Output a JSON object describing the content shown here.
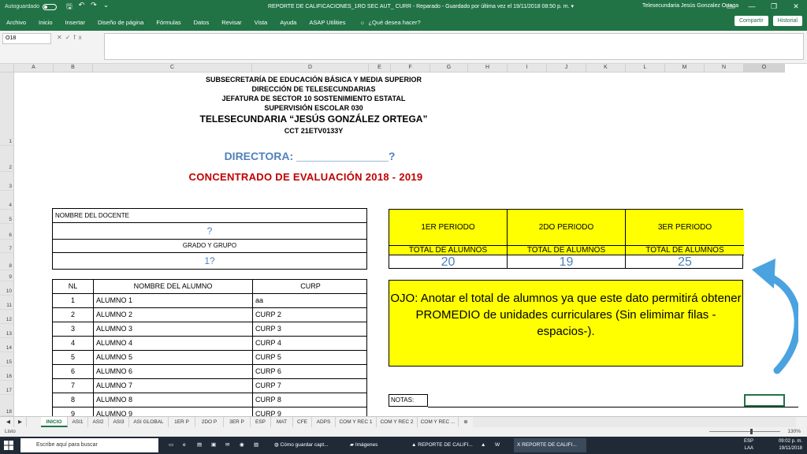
{
  "titlebar": {
    "autosave": "Autoguardado",
    "window_title": "REPORTE DE CALIFICACIONES_1RO SEC AUT_ CURR - Reparado - Guardado por última vez el 19/11/2018 08:50 p. m. ▾",
    "user": "Telesecundaria Jesús Gonzalez Ortega"
  },
  "menubar": {
    "tabs": [
      "Archivo",
      "Inicio",
      "Insertar",
      "Diseño de página",
      "Fórmulas",
      "Datos",
      "Revisar",
      "Vista",
      "Ayuda",
      "ASAP Utilities"
    ],
    "search": "¿Qué desea hacer?",
    "share": "Compartir",
    "history": "Historial"
  },
  "formula_bar": {
    "name_box": "O18",
    "value": ""
  },
  "columns": [
    "A",
    "B",
    "C",
    "D",
    "E",
    "F",
    "G",
    "H",
    "I",
    "J",
    "K",
    "L",
    "M",
    "N",
    "O"
  ],
  "rows": [
    "1",
    "2",
    "3",
    "4",
    "5",
    "6",
    "7",
    "8",
    "9",
    "10",
    "11",
    "12",
    "13",
    "14",
    "15",
    "16",
    "17",
    "18"
  ],
  "header": {
    "line1": "SUBSECRETARÍA DE EDUCACIÓN BÁSICA Y MEDIA SUPERIOR",
    "line2": "DIRECCIÓN DE TELESECUNDARIAS",
    "line3": "JEFATURA DE SECTOR 10 SOSTENIMIENTO ESTATAL",
    "line4": "SUPERVISIÓN ESCOLAR 030",
    "line5": "TELESECUNDARIA “JESÚS GONZÁLEZ ORTEGA”",
    "line6": "CCT 21ETV0133Y"
  },
  "directora": "DIRECTORA: _______________?",
  "concentrado": "CONCENTRADO DE EVALUACIÓN 2018 - 2019",
  "docente": {
    "label": "NOMBRE DEL DOCENTE",
    "value": "?",
    "grado_label": "GRADO Y GRUPO",
    "grado_value": "1?"
  },
  "periods": [
    {
      "name": "1ER PERIODO",
      "label": "TOTAL DE ALUMNOS",
      "value": "20"
    },
    {
      "name": "2DO PERIODO",
      "label": "TOTAL DE ALUMNOS",
      "value": "19"
    },
    {
      "name": "3ER PERIODO",
      "label": "TOTAL DE ALUMNOS",
      "value": "25"
    }
  ],
  "ojo_note": "OJO: Anotar el total de alumnos ya que este dato permitirá obtener PROMEDIO de unidades curriculares (Sin elimimar filas -espacios-).",
  "students_table": {
    "headers": [
      "NL",
      "NOMBRE DEL ALUMNO",
      "CURP"
    ],
    "rows": [
      [
        "1",
        "ALUMNO 1",
        "aa"
      ],
      [
        "2",
        "ALUMNO 2",
        "CURP 2"
      ],
      [
        "3",
        "ALUMNO 3",
        "CURP 3"
      ],
      [
        "4",
        "ALUMNO 4",
        "CURP 4"
      ],
      [
        "5",
        "ALUMNO 5",
        "CURP 5"
      ],
      [
        "6",
        "ALUMNO 6",
        "CURP 6"
      ],
      [
        "7",
        "ALUMNO 7",
        "CURP 7"
      ],
      [
        "8",
        "ALUMNO 8",
        "CURP 8"
      ],
      [
        "9",
        "ALUMNO 9",
        "CURP 9"
      ]
    ]
  },
  "notas_label": "NOTAS:",
  "sheet_tabs": [
    "INICIO",
    "ASI1",
    "ASI2",
    "ASI3",
    "ASI GLOBAL",
    "1ER P",
    "2DO P",
    "3ER P",
    "ESP",
    "MAT",
    "CFE",
    "ADPS",
    "COM Y REC 1",
    "COM Y REC 2",
    "COM Y REC ..."
  ],
  "status": {
    "ready": "Listo",
    "zoom": "130%"
  },
  "taskbar": {
    "search": "Escribe aquí para buscar",
    "items": [
      "Cómo guardar capt...",
      "Imágenes",
      "REPORTE DE CALIFI...",
      "REPORTE DE CALIFI..."
    ],
    "lang": "ESP",
    "lang2": "LAA",
    "time": "09:02 p. m.",
    "date": "19/11/2018"
  },
  "colors": {
    "excel_green": "#217346",
    "yellow": "#ffff00",
    "title_blue": "#4f81bd",
    "title_red": "#c00000"
  }
}
